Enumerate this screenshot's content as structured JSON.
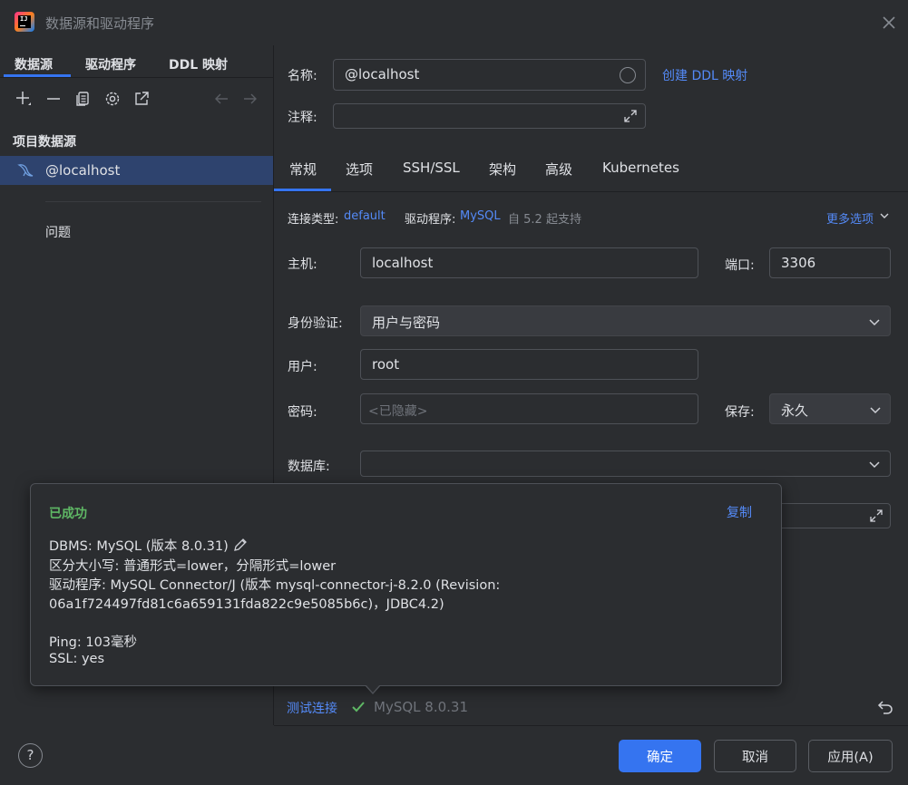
{
  "window": {
    "title": "数据源和驱动程序"
  },
  "left": {
    "tabs": [
      "数据源",
      "驱动程序",
      "DDL 映射"
    ],
    "section_title": "项目数据源",
    "selected_item": "@localhost",
    "issues_label": "问题"
  },
  "form": {
    "name_label": "名称:",
    "name_value": "@localhost",
    "create_ddl_link": "创建 DDL 映射",
    "comment_label": "注释:",
    "comment_value": "",
    "tabs": [
      "常规",
      "选项",
      "SSH/SSL",
      "架构",
      "高级",
      "Kubernetes"
    ],
    "conn_type_label": "连接类型:",
    "conn_type_value": "default",
    "driver_label": "驱动程序:",
    "driver_value": "MySQL",
    "driver_support": "自 5.2 起支持",
    "more_options": "更多选项",
    "host_label": "主机:",
    "host_value": "localhost",
    "port_label": "端口:",
    "port_value": "3306",
    "auth_label": "身份验证:",
    "auth_value": "用户与密码",
    "user_label": "用户:",
    "user_value": "root",
    "password_label": "密码:",
    "password_placeholder": "<已隐藏>",
    "save_label": "保存:",
    "save_value": "永久",
    "database_label": "数据库:",
    "database_value": ""
  },
  "popup": {
    "title": "已成功",
    "copy_label": "复制",
    "dbms": "DBMS: MySQL (版本 8.0.31)",
    "case": "区分大小写: 普通形式=lower，分隔形式=lower",
    "driver_line1": "驱动程序: MySQL Connector/J (版本 mysql-connector-j-8.2.0 (Revision:",
    "driver_line2": "06a1f724497fd81c6a659131fda822c9e5085b6c)，JDBC4.2)",
    "ping": "Ping: 103毫秒",
    "ssl": "SSL: yes"
  },
  "status": {
    "test_link": "测试连接",
    "result_text": "MySQL 8.0.31"
  },
  "buttons": {
    "ok": "确定",
    "cancel": "取消",
    "apply": "应用(A)",
    "help": "?"
  },
  "icons": {
    "add": "plus-icon",
    "remove": "minus-icon",
    "duplicate": "copy-icon",
    "settings": "gear-icon",
    "open": "external-link-icon",
    "back": "arrow-left-icon",
    "forward": "arrow-right-icon",
    "datasource": "mysql-dolphin-icon",
    "success": "check-icon",
    "revert": "undo-icon"
  },
  "colors": {
    "accent": "#3574f0",
    "link": "#548af7",
    "success": "#5fb865",
    "selection": "#2e436e"
  }
}
